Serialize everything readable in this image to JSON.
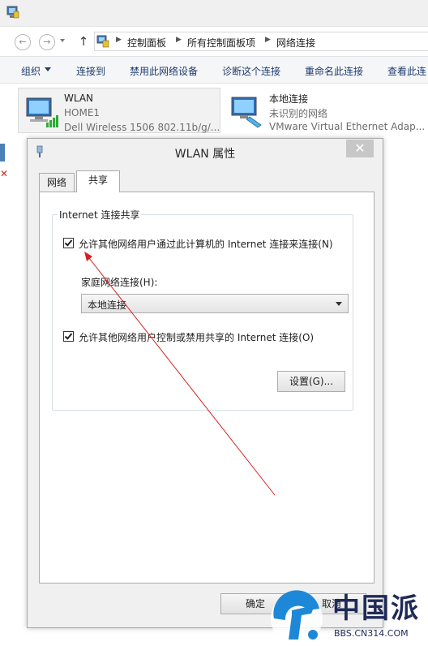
{
  "address": {
    "crumbs": [
      "控制面板",
      "所有控制面板项",
      "网络连接"
    ]
  },
  "toolbar": {
    "organize": "组织",
    "connect_to": "连接到",
    "disable_device": "禁用此网络设备",
    "diagnose": "诊断这个连接",
    "rename": "重命名此连接",
    "view_status": "查看此连"
  },
  "adapters": [
    {
      "name": "WLAN",
      "network": "HOME1",
      "device": "Dell Wireless 1506 802.11b/g/..."
    },
    {
      "name": "本地连接",
      "network": "未识别的网络",
      "device": "VMware Virtual Ethernet Adap..."
    }
  ],
  "dialog": {
    "title": "WLAN 属性",
    "close_symbol": "✕",
    "tabs": [
      "网络",
      "共享"
    ],
    "group_title": "Internet 连接共享",
    "allow_share": {
      "label": "允许其他网络用户通过此计算机的 Internet 连接来连接(N)",
      "checked": true
    },
    "home_network_label": "家庭网络连接(H):",
    "home_network_value": "本地连接",
    "allow_control": {
      "label": "允许其他网络用户控制或禁用共享的 Internet 连接(O)",
      "checked": true
    },
    "settings_button": "设置(G)...",
    "ok_button": "确定",
    "cancel_button": "取消"
  },
  "watermark": {
    "brand": "中国派",
    "url": "BBS.CN314.COM"
  },
  "colors": {
    "annotation_arrow": "#d92020",
    "watermark_blue": "#1f2a57",
    "accent_blue": "#1e88d8"
  }
}
